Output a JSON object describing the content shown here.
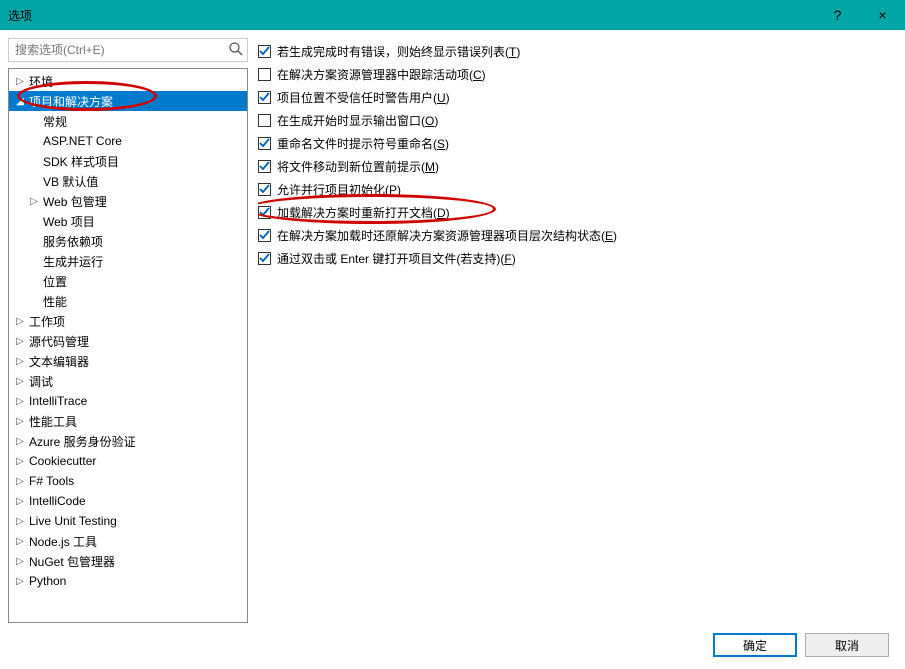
{
  "window": {
    "title": "选项",
    "help": "?",
    "close": "×"
  },
  "search": {
    "placeholder": "搜索选项(Ctrl+E)"
  },
  "tree": [
    {
      "level": 0,
      "label": "环境",
      "toggle": "▷",
      "selected": false
    },
    {
      "level": 0,
      "label": "项目和解决方案",
      "toggle": "◢",
      "selected": true
    },
    {
      "level": 1,
      "label": "常规",
      "toggle": "",
      "selected": false
    },
    {
      "level": 1,
      "label": "ASP.NET Core",
      "toggle": "",
      "selected": false
    },
    {
      "level": 1,
      "label": "SDK 样式项目",
      "toggle": "",
      "selected": false
    },
    {
      "level": 1,
      "label": "VB 默认值",
      "toggle": "",
      "selected": false
    },
    {
      "level": 1,
      "label": "Web 包管理",
      "toggle": "▷",
      "selected": false
    },
    {
      "level": 1,
      "label": "Web 项目",
      "toggle": "",
      "selected": false
    },
    {
      "level": 1,
      "label": "服务依赖项",
      "toggle": "",
      "selected": false
    },
    {
      "level": 1,
      "label": "生成并运行",
      "toggle": "",
      "selected": false
    },
    {
      "level": 1,
      "label": "位置",
      "toggle": "",
      "selected": false
    },
    {
      "level": 1,
      "label": "性能",
      "toggle": "",
      "selected": false
    },
    {
      "level": 0,
      "label": "工作项",
      "toggle": "▷",
      "selected": false
    },
    {
      "level": 0,
      "label": "源代码管理",
      "toggle": "▷",
      "selected": false
    },
    {
      "level": 0,
      "label": "文本编辑器",
      "toggle": "▷",
      "selected": false
    },
    {
      "level": 0,
      "label": "调试",
      "toggle": "▷",
      "selected": false
    },
    {
      "level": 0,
      "label": "IntelliTrace",
      "toggle": "▷",
      "selected": false
    },
    {
      "level": 0,
      "label": "性能工具",
      "toggle": "▷",
      "selected": false
    },
    {
      "level": 0,
      "label": "Azure 服务身份验证",
      "toggle": "▷",
      "selected": false
    },
    {
      "level": 0,
      "label": "Cookiecutter",
      "toggle": "▷",
      "selected": false
    },
    {
      "level": 0,
      "label": "F# Tools",
      "toggle": "▷",
      "selected": false
    },
    {
      "level": 0,
      "label": "IntelliCode",
      "toggle": "▷",
      "selected": false
    },
    {
      "level": 0,
      "label": "Live Unit Testing",
      "toggle": "▷",
      "selected": false
    },
    {
      "level": 0,
      "label": "Node.js 工具",
      "toggle": "▷",
      "selected": false
    },
    {
      "level": 0,
      "label": "NuGet 包管理器",
      "toggle": "▷",
      "selected": false
    },
    {
      "level": 0,
      "label": "Python",
      "toggle": "▷",
      "selected": false
    }
  ],
  "checks": [
    {
      "checked": true,
      "text": "若生成完成时有错误，则始终显示错误列表",
      "key": "T"
    },
    {
      "checked": false,
      "text": "在解决方案资源管理器中跟踪活动项",
      "key": "C"
    },
    {
      "checked": true,
      "text": "项目位置不受信任时警告用户",
      "key": "U"
    },
    {
      "checked": false,
      "text": "在生成开始时显示输出窗口",
      "key": "O"
    },
    {
      "checked": true,
      "text": "重命名文件时提示符号重命名",
      "key": "S"
    },
    {
      "checked": true,
      "text": "将文件移动到新位置前提示",
      "key": "M"
    },
    {
      "checked": true,
      "text": "允许并行项目初始化",
      "key": "P"
    },
    {
      "checked": true,
      "text": "加载解决方案时重新打开文档",
      "key": "D"
    },
    {
      "checked": true,
      "text": "在解决方案加载时还原解决方案资源管理器项目层次结构状态",
      "key": "E"
    },
    {
      "checked": true,
      "text": "通过双击或 Enter 键打开项目文件(若支持)",
      "key": "F"
    }
  ],
  "buttons": {
    "ok": "确定",
    "cancel": "取消"
  }
}
